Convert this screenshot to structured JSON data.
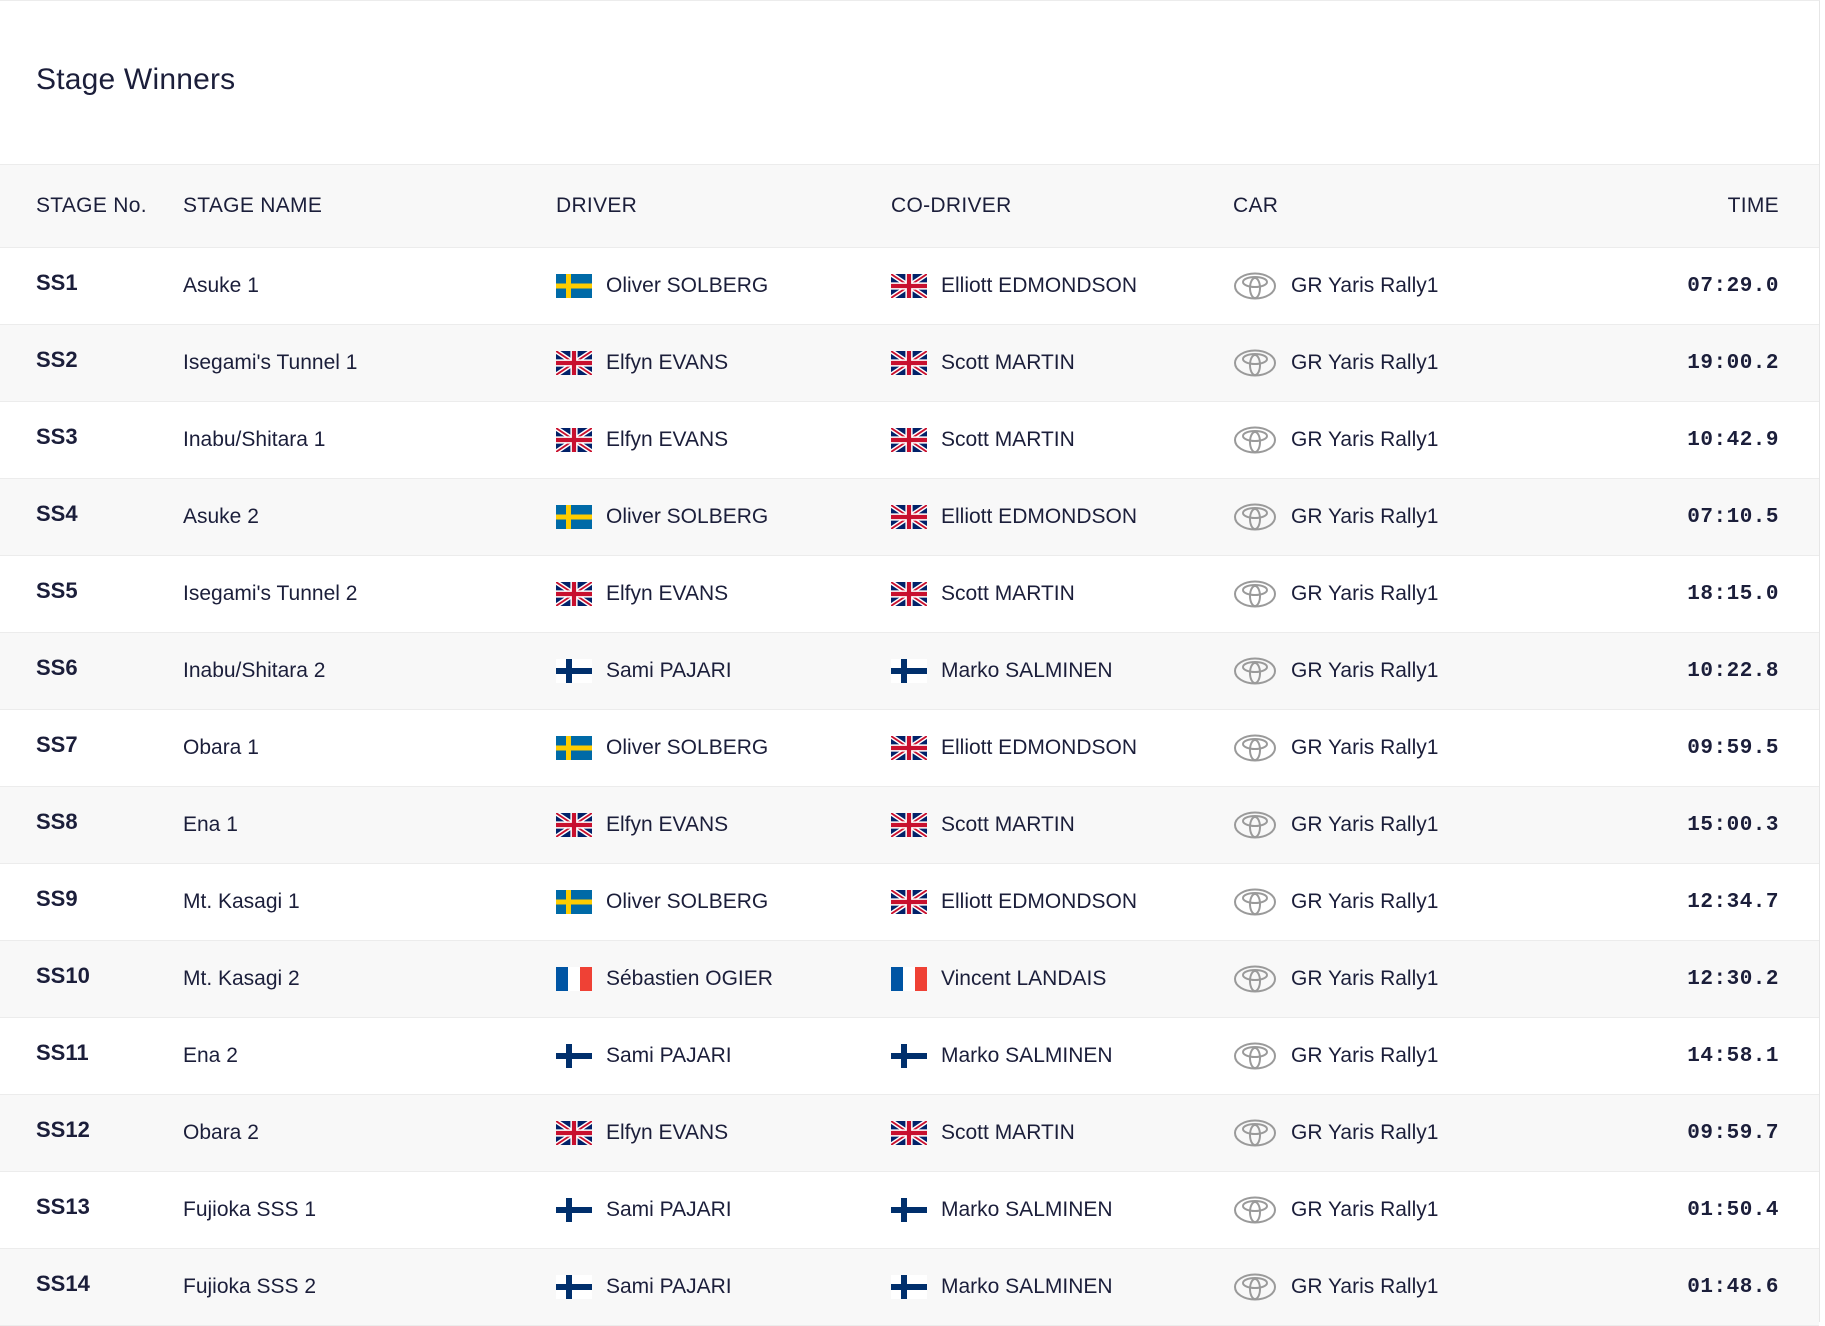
{
  "page_title": "Stage Winners",
  "columns": {
    "stage_no": "STAGE No.",
    "stage_name": "STAGE NAME",
    "driver": "DRIVER",
    "co_driver": "CO-DRIVER",
    "car": "CAR",
    "time": "TIME"
  },
  "car_logo_icon": "toyota-logo-icon",
  "rows": [
    {
      "stage": "SS1",
      "name": "Asuke 1",
      "driver": "Oliver SOLBERG",
      "driver_flag": "sweden",
      "co_driver": "Elliott EDMONDSON",
      "co_flag": "uk",
      "car": "GR Yaris Rally1",
      "time": "07:29.0"
    },
    {
      "stage": "SS2",
      "name": "Isegami's Tunnel 1",
      "driver": "Elfyn EVANS",
      "driver_flag": "uk",
      "co_driver": "Scott MARTIN",
      "co_flag": "uk",
      "car": "GR Yaris Rally1",
      "time": "19:00.2"
    },
    {
      "stage": "SS3",
      "name": "Inabu/Shitara 1",
      "driver": "Elfyn EVANS",
      "driver_flag": "uk",
      "co_driver": "Scott MARTIN",
      "co_flag": "uk",
      "car": "GR Yaris Rally1",
      "time": "10:42.9"
    },
    {
      "stage": "SS4",
      "name": "Asuke 2",
      "driver": "Oliver SOLBERG",
      "driver_flag": "sweden",
      "co_driver": "Elliott EDMONDSON",
      "co_flag": "uk",
      "car": "GR Yaris Rally1",
      "time": "07:10.5"
    },
    {
      "stage": "SS5",
      "name": "Isegami's Tunnel 2",
      "driver": "Elfyn EVANS",
      "driver_flag": "uk",
      "co_driver": "Scott MARTIN",
      "co_flag": "uk",
      "car": "GR Yaris Rally1",
      "time": "18:15.0"
    },
    {
      "stage": "SS6",
      "name": "Inabu/Shitara 2",
      "driver": "Sami PAJARI",
      "driver_flag": "finland",
      "co_driver": "Marko SALMINEN",
      "co_flag": "finland",
      "car": "GR Yaris Rally1",
      "time": "10:22.8"
    },
    {
      "stage": "SS7",
      "name": "Obara 1",
      "driver": "Oliver SOLBERG",
      "driver_flag": "sweden",
      "co_driver": "Elliott EDMONDSON",
      "co_flag": "uk",
      "car": "GR Yaris Rally1",
      "time": "09:59.5"
    },
    {
      "stage": "SS8",
      "name": "Ena 1",
      "driver": "Elfyn EVANS",
      "driver_flag": "uk",
      "co_driver": "Scott MARTIN",
      "co_flag": "uk",
      "car": "GR Yaris Rally1",
      "time": "15:00.3"
    },
    {
      "stage": "SS9",
      "name": "Mt. Kasagi 1",
      "driver": "Oliver SOLBERG",
      "driver_flag": "sweden",
      "co_driver": "Elliott EDMONDSON",
      "co_flag": "uk",
      "car": "GR Yaris Rally1",
      "time": "12:34.7"
    },
    {
      "stage": "SS10",
      "name": "Mt. Kasagi 2",
      "driver": "Sébastien OGIER",
      "driver_flag": "france",
      "co_driver": "Vincent LANDAIS",
      "co_flag": "france",
      "car": "GR Yaris Rally1",
      "time": "12:30.2"
    },
    {
      "stage": "SS11",
      "name": "Ena 2",
      "driver": "Sami PAJARI",
      "driver_flag": "finland",
      "co_driver": "Marko SALMINEN",
      "co_flag": "finland",
      "car": "GR Yaris Rally1",
      "time": "14:58.1"
    },
    {
      "stage": "SS12",
      "name": "Obara 2",
      "driver": "Elfyn EVANS",
      "driver_flag": "uk",
      "co_driver": "Scott MARTIN",
      "co_flag": "uk",
      "car": "GR Yaris Rally1",
      "time": "09:59.7"
    },
    {
      "stage": "SS13",
      "name": "Fujioka SSS 1",
      "driver": "Sami PAJARI",
      "driver_flag": "finland",
      "co_driver": "Marko SALMINEN",
      "co_flag": "finland",
      "car": "GR Yaris Rally1",
      "time": "01:50.4"
    },
    {
      "stage": "SS14",
      "name": "Fujioka SSS 2",
      "driver": "Sami PAJARI",
      "driver_flag": "finland",
      "co_driver": "Marko SALMINEN",
      "co_flag": "finland",
      "car": "GR Yaris Rally1",
      "time": "01:48.6"
    }
  ]
}
